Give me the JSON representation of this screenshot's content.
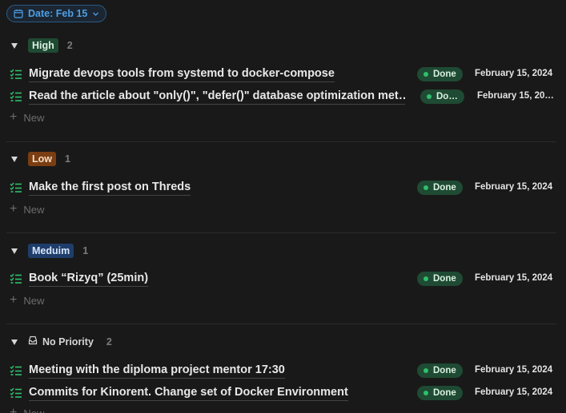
{
  "filter": {
    "label": "Date: Feb 15"
  },
  "new_label": "New",
  "groups": [
    {
      "tag": "High",
      "count": "2",
      "tasks": [
        {
          "title": "Migrate devops tools from systemd to docker-compose",
          "status": "Done",
          "date": "February 15, 2024"
        },
        {
          "title": "Read the article about \"only()\", \"defer()\" database optimization met…",
          "status": "Do…",
          "date": "February 15, 20…"
        }
      ]
    },
    {
      "tag": "Low",
      "count": "1",
      "tasks": [
        {
          "title": "Make the first post on Threds",
          "status": "Done",
          "date": "February 15, 2024"
        }
      ]
    },
    {
      "tag": "Meduim",
      "count": "1",
      "tasks": [
        {
          "title": "Book “Rizyq” (25min)",
          "status": "Done",
          "date": "February 15, 2024"
        }
      ]
    },
    {
      "tag": "No Priority",
      "count": "2",
      "tasks": [
        {
          "title": "Meeting with the diploma project mentor 17:30",
          "status": "Done",
          "date": "February 15, 2024"
        },
        {
          "title": "Commits for Kinorent. Change set of Docker Environment",
          "status": "Done",
          "date": "February 15, 2024"
        }
      ]
    }
  ],
  "colors": {
    "background": "#191919",
    "accent": "#4c9fe6",
    "status_done_bg": "#1f4a33",
    "status_done_dot": "#2fbf6d"
  }
}
